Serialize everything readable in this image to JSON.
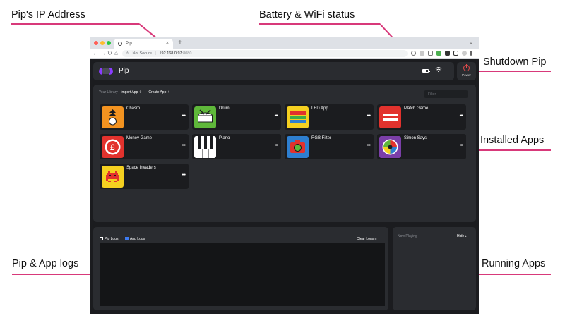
{
  "annotations": {
    "ip": "Pip's IP Address",
    "battery": "Battery & WiFi status",
    "shutdown": "Shutdown Pip",
    "installed": "Installed Apps",
    "logs": "Pip & App logs",
    "running": "Running Apps"
  },
  "browser": {
    "tab_title": "Pip",
    "tab_close": "×",
    "new_tab": "+",
    "tab_menu": "⌄",
    "security_label": "Not Secure",
    "url_host": "192.168.0.97",
    "url_port": ":8080"
  },
  "header": {
    "title": "Pip",
    "power_label": "Power"
  },
  "library": {
    "label": "Your Library",
    "import_label": "Import App",
    "create_label": "Create App",
    "filter_placeholder": "Filter"
  },
  "apps": [
    {
      "name": "Chasm",
      "icon": "chasm-icon",
      "color": "#f39320"
    },
    {
      "name": "Drum",
      "icon": "drum-icon",
      "color": "#5fb83a"
    },
    {
      "name": "LED App",
      "icon": "led-icon",
      "color": "#f5d020"
    },
    {
      "name": "Match Game",
      "icon": "match-icon",
      "color": "#e2322d"
    },
    {
      "name": "Money Game",
      "icon": "pound-icon",
      "color": "#e2322d"
    },
    {
      "name": "Piano",
      "icon": "piano-icon",
      "color": "#ffffff"
    },
    {
      "name": "RGB Filter",
      "icon": "camera-icon",
      "color": "#2e7fd0"
    },
    {
      "name": "Simon Says",
      "icon": "simon-icon",
      "color": "#7b3fa8"
    },
    {
      "name": "Space Invaders",
      "icon": "invader-icon",
      "color": "#f5d020"
    }
  ],
  "logs": {
    "pip_logs_label": "Pip Logs",
    "pip_logs_checked": false,
    "app_logs_label": "App Logs",
    "app_logs_checked": true,
    "clear_label": "Clear Logs"
  },
  "running": {
    "now_playing": "Now Playing",
    "hide_label": "Hide"
  },
  "colors": {
    "accent": "#d8397a",
    "app_bg": "#1b1c1f",
    "panel_bg": "#2a2c30",
    "power_red": "#e24a4a"
  }
}
